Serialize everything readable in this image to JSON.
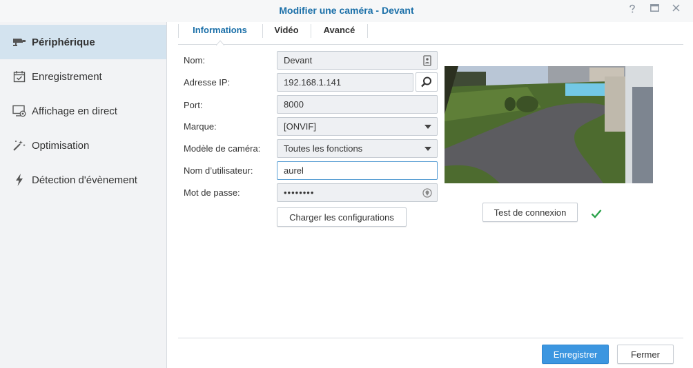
{
  "window": {
    "title": "Modifier une caméra - Devant",
    "help_icon": "question-icon",
    "maximize_icon": "maximize-icon",
    "close_icon": "close-icon"
  },
  "sidebar": {
    "items": [
      {
        "label": "Périphérique",
        "icon": "camera-icon",
        "active": true
      },
      {
        "label": "Enregistrement",
        "icon": "calendar-check-icon",
        "active": false
      },
      {
        "label": "Affichage en direct",
        "icon": "monitor-icon",
        "active": false
      },
      {
        "label": "Optimisation",
        "icon": "magic-wand-icon",
        "active": false
      },
      {
        "label": "Détection d'évènement",
        "icon": "lightning-icon",
        "active": false
      }
    ]
  },
  "tabs": [
    {
      "label": "Informations",
      "active": true
    },
    {
      "label": "Vidéo",
      "active": false
    },
    {
      "label": "Avancé",
      "active": false
    }
  ],
  "form": {
    "name_label": "Nom:",
    "name_value": "Devant",
    "ip_label": "Adresse IP:",
    "ip_value": "192.168.1.141",
    "port_label": "Port:",
    "port_value": "8000",
    "brand_label": "Marque:",
    "brand_value": "[ONVIF]",
    "model_label": "Modèle de caméra:",
    "model_value": "Toutes les fonctions",
    "user_label": "Nom d’utilisateur:",
    "user_value": "aurel",
    "password_label": "Mot de passe:",
    "password_value": "••••••••",
    "load_config_button": "Charger les configurations"
  },
  "preview": {
    "test_button": "Test de connexion",
    "status_icon": "checkmark-icon",
    "status_color": "#2aa24a"
  },
  "footer": {
    "save_button": "Enregistrer",
    "close_button": "Fermer"
  },
  "colors": {
    "accent": "#1a6fa8",
    "primary_button": "#3c96e0",
    "sidebar_active": "#d3e3ef"
  }
}
